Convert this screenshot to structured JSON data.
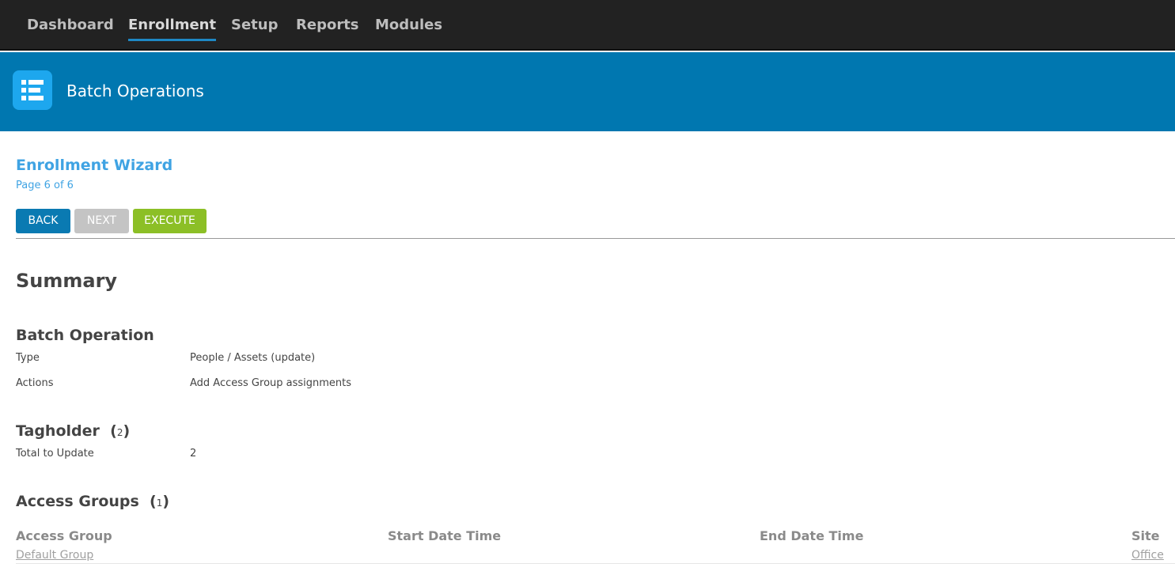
{
  "nav": {
    "items": [
      {
        "label": "Dashboard"
      },
      {
        "label": "Enrollment"
      },
      {
        "label": "Setup"
      },
      {
        "label": "Reports"
      },
      {
        "label": "Modules"
      }
    ],
    "active": "Enrollment"
  },
  "header": {
    "icon": "list-icon",
    "title": "Batch Operations"
  },
  "wizard": {
    "title": "Enrollment Wizard",
    "page": "Page 6 of 6",
    "buttons": {
      "back": "BACK",
      "next": "NEXT",
      "execute": "EXECUTE"
    }
  },
  "summary": {
    "title": "Summary",
    "batch_operation": {
      "heading": "Batch Operation",
      "type_label": "Type",
      "type_value": "People / Assets (update)",
      "actions_label": "Actions",
      "actions_value": "Add Access Group assignments"
    },
    "tagholder": {
      "heading": "Tagholder",
      "count": "2",
      "total_label": "Total to Update",
      "total_value": "2"
    },
    "access_groups": {
      "heading": "Access Groups",
      "count": "1",
      "columns": {
        "group": "Access Group",
        "start": "Start Date Time",
        "end": "End Date Time",
        "site": "Site"
      },
      "rows": [
        {
          "group": "Default Group",
          "start": "",
          "end": "",
          "site": "Office"
        }
      ]
    }
  },
  "colors": {
    "topnav": "#222222",
    "header": "#0077b0",
    "accent": "#3fa3e3",
    "back": "#0a7ab2",
    "next_disabled": "#c4c4c4",
    "execute": "#8cbf26"
  }
}
